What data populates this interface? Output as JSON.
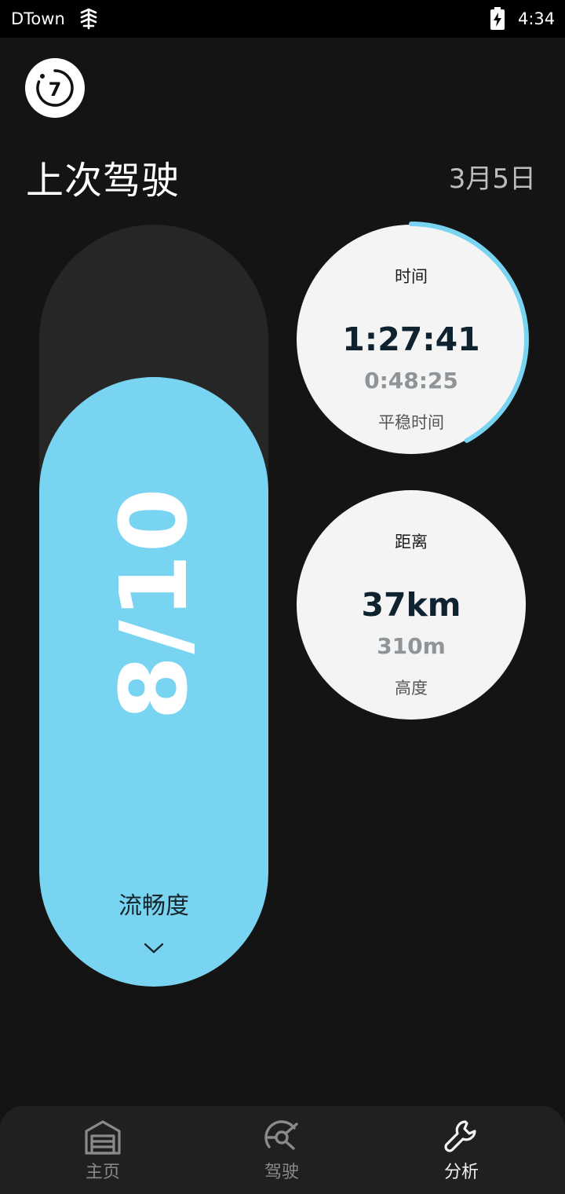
{
  "status_bar": {
    "app_name": "DTown",
    "time": "4:34"
  },
  "header": {
    "logo_text": "7",
    "title": "上次驾驶",
    "date": "3月5日"
  },
  "score": {
    "value": "8/10",
    "label": "流畅度",
    "fill_fraction": 0.8,
    "accent": "#79d4f2"
  },
  "time_stat": {
    "title": "时间",
    "main": "1:27:41",
    "sub": "0:48:25",
    "caption": "平稳时间",
    "progress_fraction": 0.42,
    "accent": "#79d4f2"
  },
  "distance_stat": {
    "title": "距离",
    "main": "37km",
    "sub": "310m",
    "caption": "高度"
  },
  "nav": {
    "items": [
      {
        "label": "主页",
        "icon": "garage-icon",
        "active": false
      },
      {
        "label": "驾驶",
        "icon": "steering-wheel-icon",
        "active": false
      },
      {
        "label": "分析",
        "icon": "wrench-icon",
        "active": true
      }
    ]
  }
}
